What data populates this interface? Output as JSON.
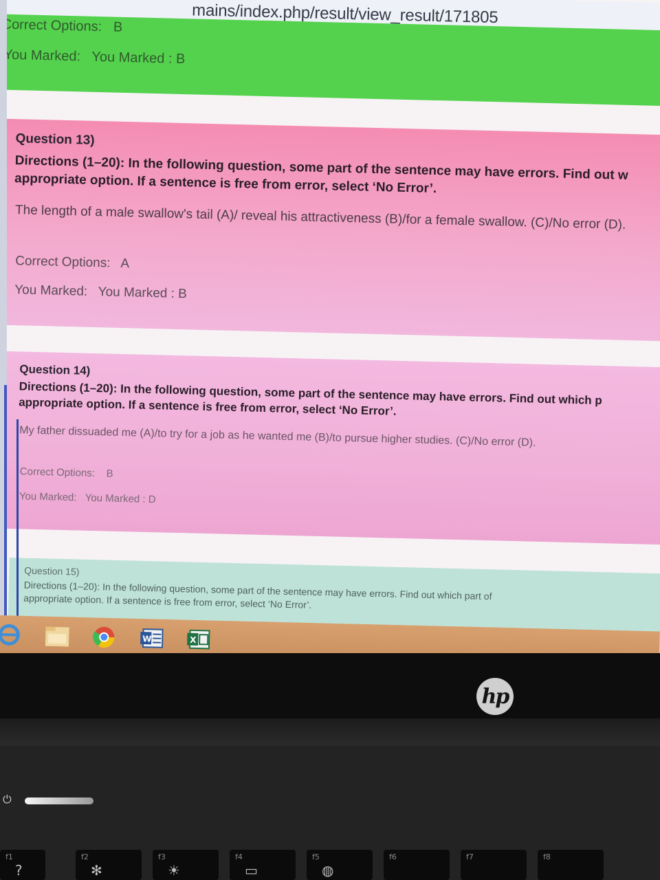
{
  "browser": {
    "url_text": "mains/index.php/result/view_result/171805"
  },
  "q12_tail": {
    "correct_label": "Correct Options:",
    "correct_value": "B",
    "marked_label": "You Marked:",
    "marked_value": "You Marked : B"
  },
  "questions": [
    {
      "title": "Question 13)",
      "directions": "Directions (1–20): In the following question, some part of the sentence may have errors. Find out w",
      "directions_line2": "appropriate option. If a sentence is free from error, select ‘No Error’.",
      "sentence": "The length of a male swallow's tail (A)/ reveal his attractiveness (B)/for a female swallow. (C)/No error (D).",
      "correct_label": "Correct Options:",
      "correct_value": "A",
      "marked_label": "You Marked:",
      "marked_value": "You Marked : B"
    },
    {
      "title": "Question 14)",
      "directions": "Directions (1–20): In the following question, some part of the sentence may have errors. Find out which p",
      "directions_line2": "appropriate option. If a sentence is free from error, select ‘No Error’.",
      "sentence": "My father dissuaded me (A)/to try for a job as he wanted me (B)/to pursue higher studies. (C)/No error (D).",
      "correct_label": "Correct Options:",
      "correct_value": "B",
      "marked_label": "You Marked:",
      "marked_value": "You Marked : D"
    },
    {
      "title": "Question 15)",
      "directions": "Directions (1–20): In the following question, some part of the sentence may have errors. Find out which part of",
      "directions_line2": "appropriate option. If a sentence is free from error, select ‘No Error’."
    }
  ],
  "colors": {
    "correct_card": "#54d24e",
    "wrong_card": "#f3a9cc",
    "neutral_card": "#bfe2d8",
    "taskbar": "#d8a06e"
  },
  "taskbar_icons": [
    "ie-icon",
    "file-explorer-icon",
    "chrome-icon",
    "word-icon",
    "excel-icon"
  ],
  "laptop": {
    "brand_logo": "hp",
    "fkeys": [
      "f1",
      "f2",
      "f3",
      "f4",
      "f5",
      "f6",
      "f7",
      "f8"
    ]
  }
}
